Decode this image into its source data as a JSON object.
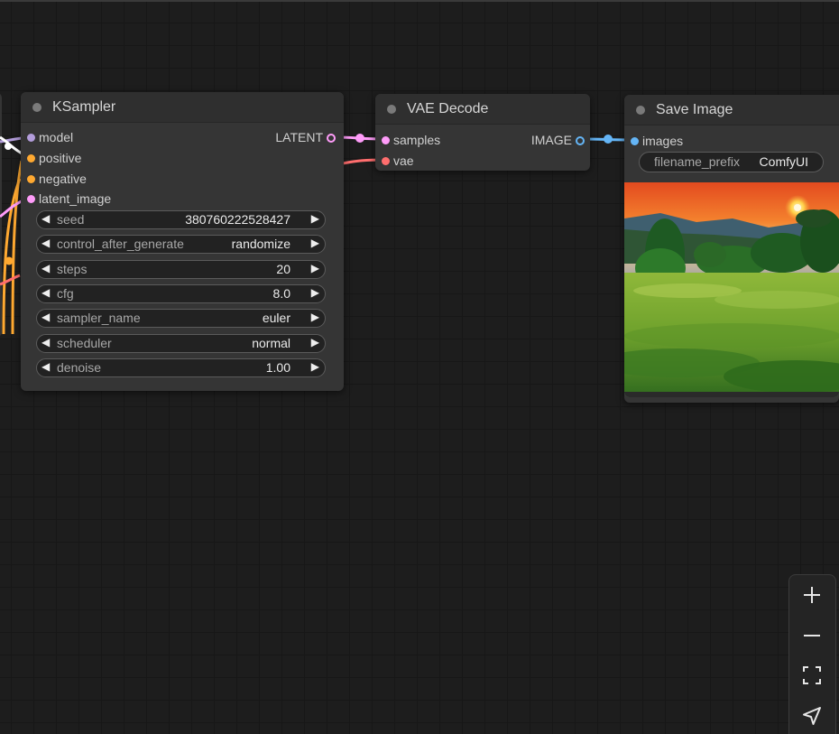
{
  "ksampler": {
    "title": "KSampler",
    "inputs": [
      "model",
      "positive",
      "negative",
      "latent_image"
    ],
    "output": "LATENT",
    "widgets": [
      {
        "name": "seed",
        "value": "380760222528427"
      },
      {
        "name": "control_after_generate",
        "value": "randomize"
      },
      {
        "name": "steps",
        "value": "20"
      },
      {
        "name": "cfg",
        "value": "8.0"
      },
      {
        "name": "sampler_name",
        "value": "euler"
      },
      {
        "name": "scheduler",
        "value": "normal"
      },
      {
        "name": "denoise",
        "value": "1.00"
      }
    ]
  },
  "vae_decode": {
    "title": "VAE Decode",
    "inputs": [
      "samples",
      "vae"
    ],
    "output": "IMAGE"
  },
  "save_image": {
    "title": "Save Image",
    "inputs": [
      "images"
    ],
    "widget": {
      "name": "filename_prefix",
      "value": "ComfyUI"
    }
  },
  "slot_colors": {
    "model": "#b39ddb",
    "conditioning": "#ffa931",
    "latent": "#ff9cf9",
    "vae": "#ff6e6e",
    "image": "#64b5f6"
  },
  "canvas_controls": [
    "zoom-in-icon",
    "zoom-out-icon",
    "fit-view-icon",
    "locate-icon"
  ]
}
